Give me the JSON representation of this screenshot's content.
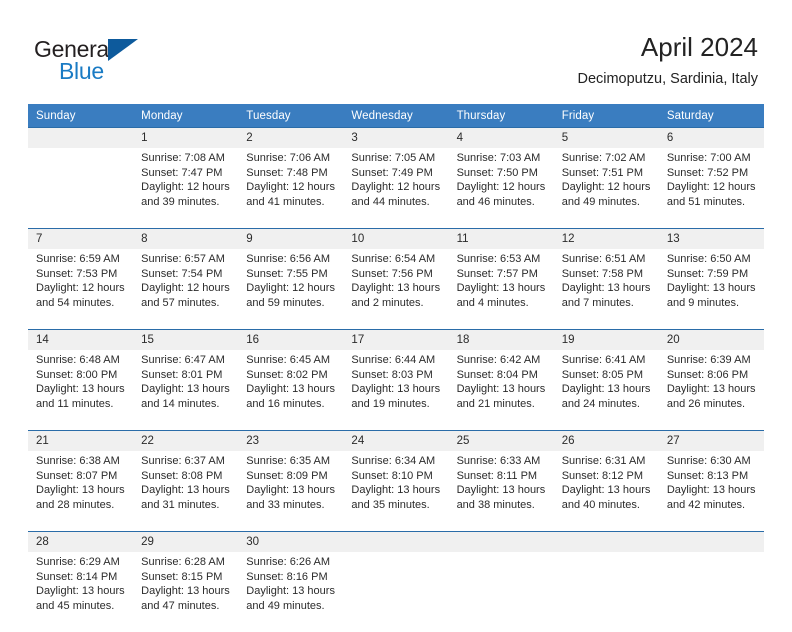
{
  "logo": {
    "word1": "General",
    "word2": "Blue",
    "flag_color": "#0d5a9c",
    "word1_color": "#231f20",
    "word2_color": "#1a7bc4"
  },
  "header": {
    "title": "April 2024",
    "subtitle": "Decimoputzu, Sardinia, Italy"
  },
  "theme": {
    "header_bg": "#3a7dc0",
    "header_text": "#ffffff",
    "daynum_bg": "#f0f0f0",
    "row_divider": "#2a6ca8",
    "cell_text": "#2b2b2b"
  },
  "weekdays": [
    "Sunday",
    "Monday",
    "Tuesday",
    "Wednesday",
    "Thursday",
    "Friday",
    "Saturday"
  ],
  "weeks": [
    {
      "days": [
        {
          "num": "",
          "sunrise": "",
          "sunset": "",
          "daylight1": "",
          "daylight2": ""
        },
        {
          "num": "1",
          "sunrise": "Sunrise: 7:08 AM",
          "sunset": "Sunset: 7:47 PM",
          "daylight1": "Daylight: 12 hours",
          "daylight2": "and 39 minutes."
        },
        {
          "num": "2",
          "sunrise": "Sunrise: 7:06 AM",
          "sunset": "Sunset: 7:48 PM",
          "daylight1": "Daylight: 12 hours",
          "daylight2": "and 41 minutes."
        },
        {
          "num": "3",
          "sunrise": "Sunrise: 7:05 AM",
          "sunset": "Sunset: 7:49 PM",
          "daylight1": "Daylight: 12 hours",
          "daylight2": "and 44 minutes."
        },
        {
          "num": "4",
          "sunrise": "Sunrise: 7:03 AM",
          "sunset": "Sunset: 7:50 PM",
          "daylight1": "Daylight: 12 hours",
          "daylight2": "and 46 minutes."
        },
        {
          "num": "5",
          "sunrise": "Sunrise: 7:02 AM",
          "sunset": "Sunset: 7:51 PM",
          "daylight1": "Daylight: 12 hours",
          "daylight2": "and 49 minutes."
        },
        {
          "num": "6",
          "sunrise": "Sunrise: 7:00 AM",
          "sunset": "Sunset: 7:52 PM",
          "daylight1": "Daylight: 12 hours",
          "daylight2": "and 51 minutes."
        }
      ]
    },
    {
      "days": [
        {
          "num": "7",
          "sunrise": "Sunrise: 6:59 AM",
          "sunset": "Sunset: 7:53 PM",
          "daylight1": "Daylight: 12 hours",
          "daylight2": "and 54 minutes."
        },
        {
          "num": "8",
          "sunrise": "Sunrise: 6:57 AM",
          "sunset": "Sunset: 7:54 PM",
          "daylight1": "Daylight: 12 hours",
          "daylight2": "and 57 minutes."
        },
        {
          "num": "9",
          "sunrise": "Sunrise: 6:56 AM",
          "sunset": "Sunset: 7:55 PM",
          "daylight1": "Daylight: 12 hours",
          "daylight2": "and 59 minutes."
        },
        {
          "num": "10",
          "sunrise": "Sunrise: 6:54 AM",
          "sunset": "Sunset: 7:56 PM",
          "daylight1": "Daylight: 13 hours",
          "daylight2": "and 2 minutes."
        },
        {
          "num": "11",
          "sunrise": "Sunrise: 6:53 AM",
          "sunset": "Sunset: 7:57 PM",
          "daylight1": "Daylight: 13 hours",
          "daylight2": "and 4 minutes."
        },
        {
          "num": "12",
          "sunrise": "Sunrise: 6:51 AM",
          "sunset": "Sunset: 7:58 PM",
          "daylight1": "Daylight: 13 hours",
          "daylight2": "and 7 minutes."
        },
        {
          "num": "13",
          "sunrise": "Sunrise: 6:50 AM",
          "sunset": "Sunset: 7:59 PM",
          "daylight1": "Daylight: 13 hours",
          "daylight2": "and 9 minutes."
        }
      ]
    },
    {
      "days": [
        {
          "num": "14",
          "sunrise": "Sunrise: 6:48 AM",
          "sunset": "Sunset: 8:00 PM",
          "daylight1": "Daylight: 13 hours",
          "daylight2": "and 11 minutes."
        },
        {
          "num": "15",
          "sunrise": "Sunrise: 6:47 AM",
          "sunset": "Sunset: 8:01 PM",
          "daylight1": "Daylight: 13 hours",
          "daylight2": "and 14 minutes."
        },
        {
          "num": "16",
          "sunrise": "Sunrise: 6:45 AM",
          "sunset": "Sunset: 8:02 PM",
          "daylight1": "Daylight: 13 hours",
          "daylight2": "and 16 minutes."
        },
        {
          "num": "17",
          "sunrise": "Sunrise: 6:44 AM",
          "sunset": "Sunset: 8:03 PM",
          "daylight1": "Daylight: 13 hours",
          "daylight2": "and 19 minutes."
        },
        {
          "num": "18",
          "sunrise": "Sunrise: 6:42 AM",
          "sunset": "Sunset: 8:04 PM",
          "daylight1": "Daylight: 13 hours",
          "daylight2": "and 21 minutes."
        },
        {
          "num": "19",
          "sunrise": "Sunrise: 6:41 AM",
          "sunset": "Sunset: 8:05 PM",
          "daylight1": "Daylight: 13 hours",
          "daylight2": "and 24 minutes."
        },
        {
          "num": "20",
          "sunrise": "Sunrise: 6:39 AM",
          "sunset": "Sunset: 8:06 PM",
          "daylight1": "Daylight: 13 hours",
          "daylight2": "and 26 minutes."
        }
      ]
    },
    {
      "days": [
        {
          "num": "21",
          "sunrise": "Sunrise: 6:38 AM",
          "sunset": "Sunset: 8:07 PM",
          "daylight1": "Daylight: 13 hours",
          "daylight2": "and 28 minutes."
        },
        {
          "num": "22",
          "sunrise": "Sunrise: 6:37 AM",
          "sunset": "Sunset: 8:08 PM",
          "daylight1": "Daylight: 13 hours",
          "daylight2": "and 31 minutes."
        },
        {
          "num": "23",
          "sunrise": "Sunrise: 6:35 AM",
          "sunset": "Sunset: 8:09 PM",
          "daylight1": "Daylight: 13 hours",
          "daylight2": "and 33 minutes."
        },
        {
          "num": "24",
          "sunrise": "Sunrise: 6:34 AM",
          "sunset": "Sunset: 8:10 PM",
          "daylight1": "Daylight: 13 hours",
          "daylight2": "and 35 minutes."
        },
        {
          "num": "25",
          "sunrise": "Sunrise: 6:33 AM",
          "sunset": "Sunset: 8:11 PM",
          "daylight1": "Daylight: 13 hours",
          "daylight2": "and 38 minutes."
        },
        {
          "num": "26",
          "sunrise": "Sunrise: 6:31 AM",
          "sunset": "Sunset: 8:12 PM",
          "daylight1": "Daylight: 13 hours",
          "daylight2": "and 40 minutes."
        },
        {
          "num": "27",
          "sunrise": "Sunrise: 6:30 AM",
          "sunset": "Sunset: 8:13 PM",
          "daylight1": "Daylight: 13 hours",
          "daylight2": "and 42 minutes."
        }
      ]
    },
    {
      "days": [
        {
          "num": "28",
          "sunrise": "Sunrise: 6:29 AM",
          "sunset": "Sunset: 8:14 PM",
          "daylight1": "Daylight: 13 hours",
          "daylight2": "and 45 minutes."
        },
        {
          "num": "29",
          "sunrise": "Sunrise: 6:28 AM",
          "sunset": "Sunset: 8:15 PM",
          "daylight1": "Daylight: 13 hours",
          "daylight2": "and 47 minutes."
        },
        {
          "num": "30",
          "sunrise": "Sunrise: 6:26 AM",
          "sunset": "Sunset: 8:16 PM",
          "daylight1": "Daylight: 13 hours",
          "daylight2": "and 49 minutes."
        },
        {
          "num": "",
          "sunrise": "",
          "sunset": "",
          "daylight1": "",
          "daylight2": ""
        },
        {
          "num": "",
          "sunrise": "",
          "sunset": "",
          "daylight1": "",
          "daylight2": ""
        },
        {
          "num": "",
          "sunrise": "",
          "sunset": "",
          "daylight1": "",
          "daylight2": ""
        },
        {
          "num": "",
          "sunrise": "",
          "sunset": "",
          "daylight1": "",
          "daylight2": ""
        }
      ]
    }
  ]
}
